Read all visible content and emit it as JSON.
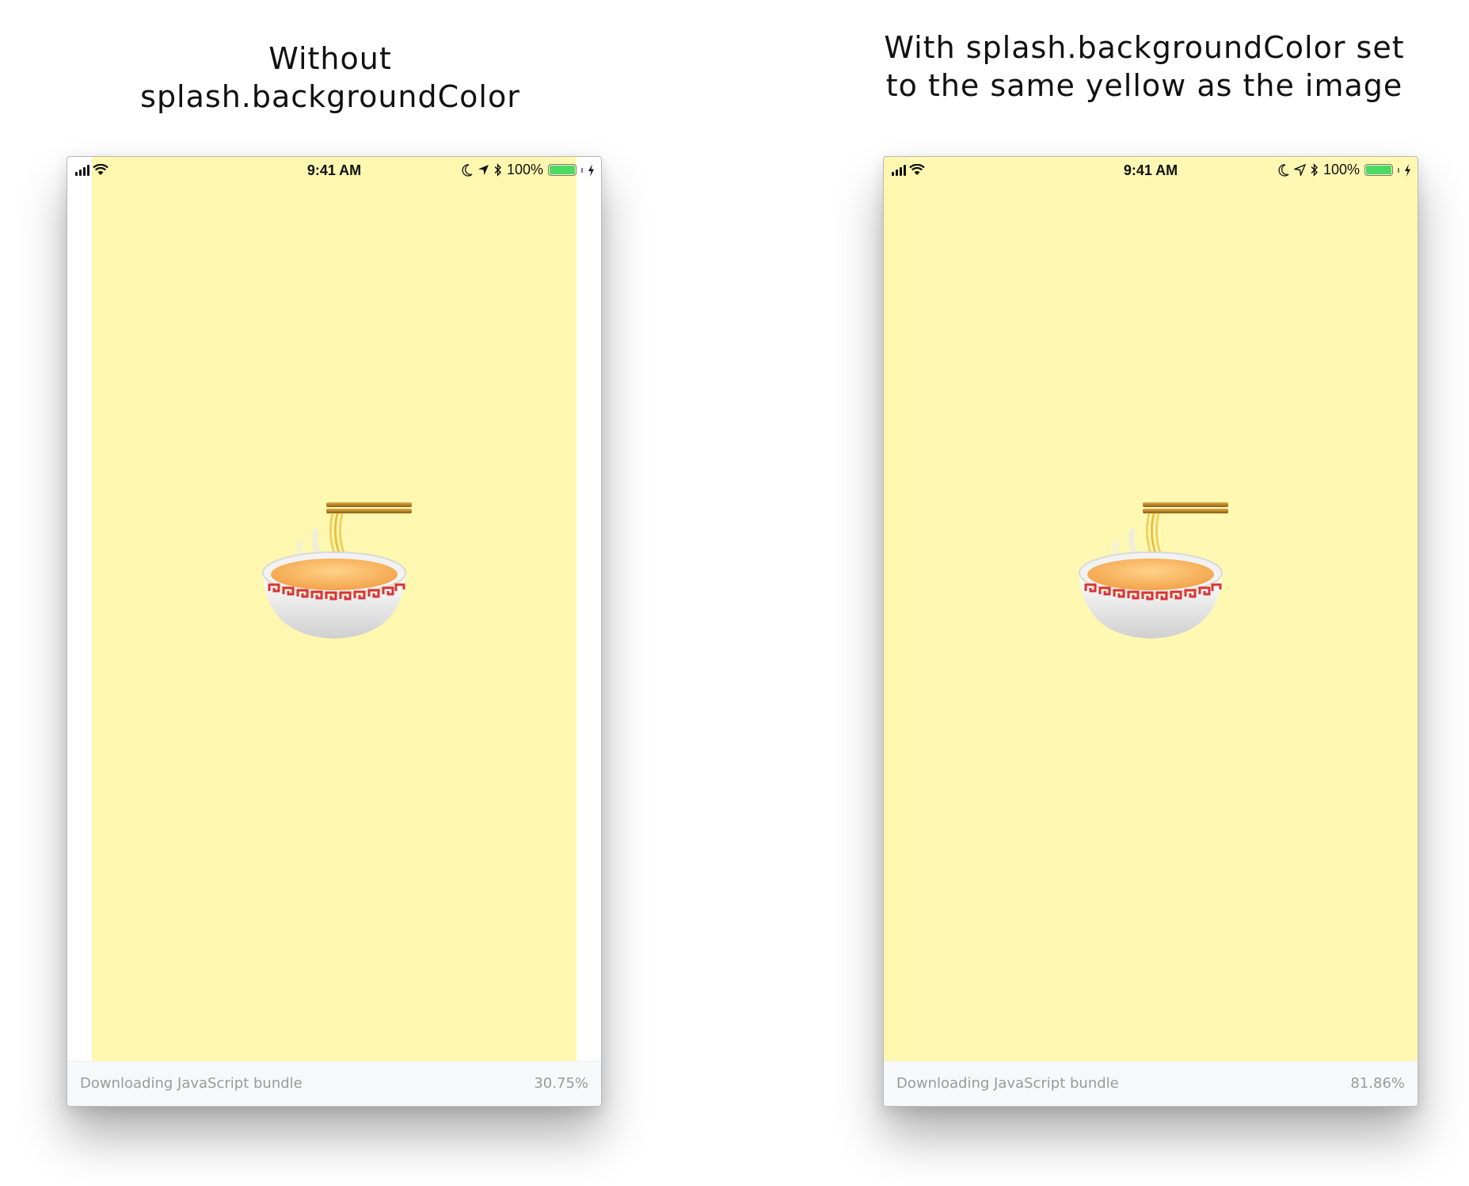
{
  "captions": {
    "left": [
      "Without",
      "splash.backgroundColor"
    ],
    "right": [
      "With splash.backgroundColor set",
      "to the same yellow as the image"
    ]
  },
  "phones": {
    "left": {
      "status": {
        "time": "9:41 AM",
        "battery": "100%"
      },
      "loading": {
        "label": "Downloading JavaScript bundle",
        "percent": "30.75%",
        "progress": 30.75
      }
    },
    "right": {
      "status": {
        "time": "9:41 AM",
        "battery": "100%"
      },
      "loading": {
        "label": "Downloading JavaScript bundle",
        "percent": "81.86%",
        "progress": 81.86
      }
    }
  },
  "colors": {
    "splash_yellow": "#fdf7b0",
    "battery_green": "#4cd964",
    "loader_background": "#f7f8fa",
    "loader_text": "#9a9a9a"
  },
  "icons": [
    "signal-icon",
    "wifi-icon",
    "moon-icon",
    "location-icon",
    "bluetooth-icon",
    "battery-icon",
    "charging-icon",
    "ramen-bowl-icon"
  ]
}
